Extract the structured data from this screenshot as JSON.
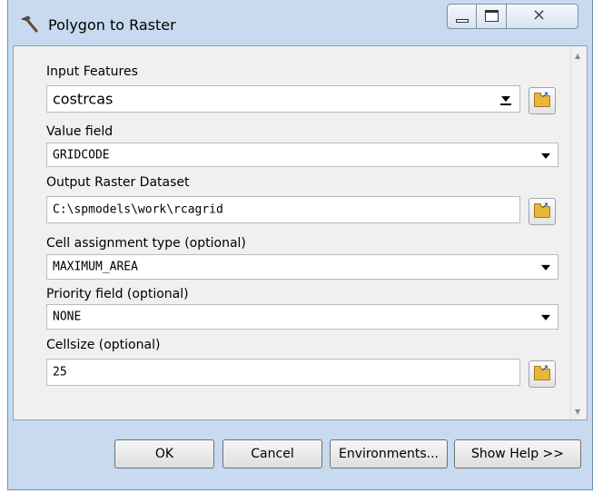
{
  "window": {
    "title": "Polygon to Raster",
    "close_glyph": "⨯"
  },
  "icons": {
    "app": "hammer-icon",
    "browse": "folder-open-icon"
  },
  "fields": {
    "input_features": {
      "label": "Input Features",
      "value": "costrcas"
    },
    "value_field": {
      "label": "Value field",
      "value": "GRIDCODE"
    },
    "output_raster": {
      "label": "Output Raster Dataset",
      "value": "C:\\spmodels\\work\\rcagrid"
    },
    "cell_assignment": {
      "label": "Cell assignment type (optional)",
      "value": "MAXIMUM_AREA"
    },
    "priority_field": {
      "label": "Priority field (optional)",
      "value": "NONE"
    },
    "cellsize": {
      "label": "Cellsize (optional)",
      "value": "25"
    }
  },
  "buttons": {
    "ok": "OK",
    "cancel": "Cancel",
    "environments": "Environments...",
    "show_help": "Show Help >>"
  },
  "colors": {
    "frame": "#c7daef",
    "panel": "#f0f0f0",
    "folder": "#e8b73a"
  }
}
